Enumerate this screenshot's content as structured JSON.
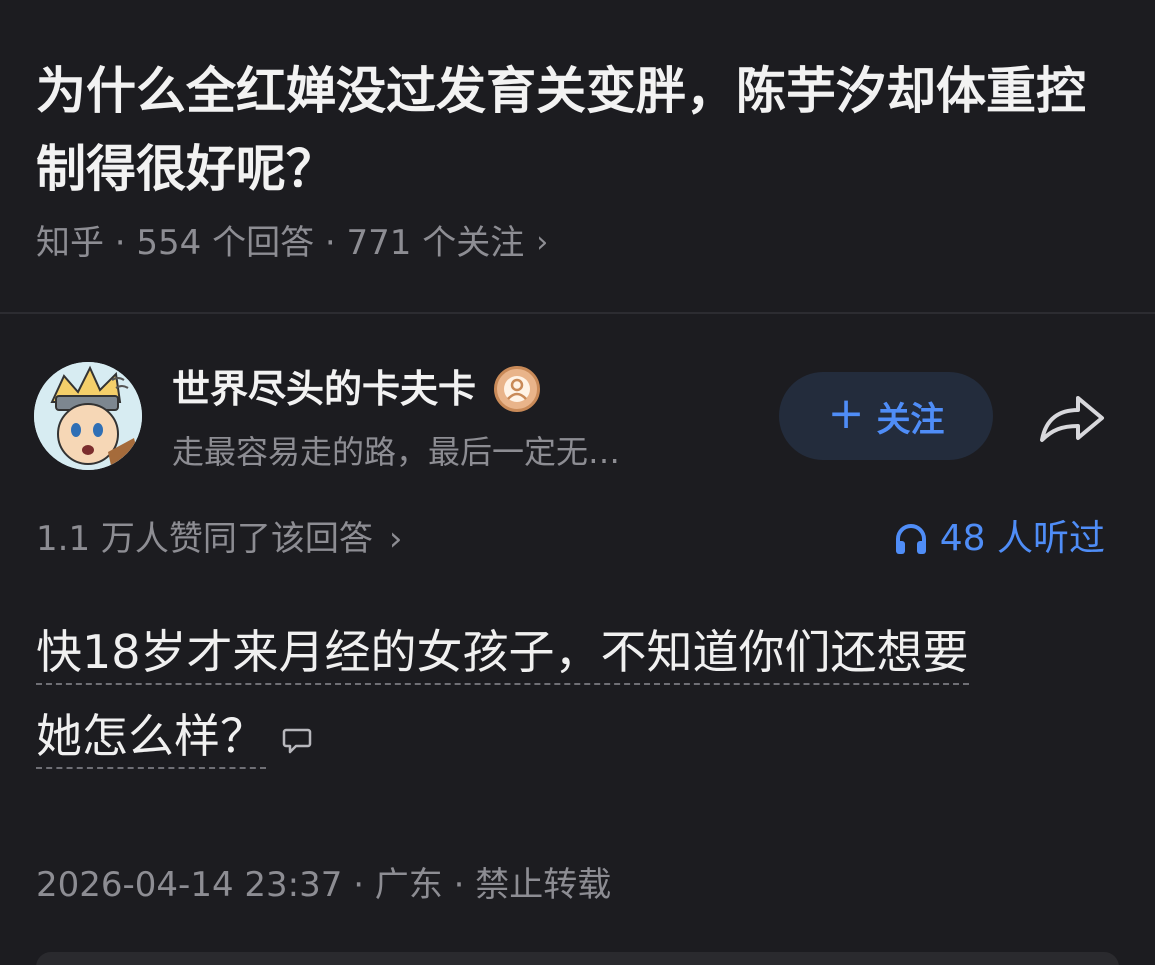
{
  "question": {
    "title": "为什么全红婵没过发育关变胖，陈芋汐却体重控制得很好呢？",
    "meta": "知乎 · 554 个回答 · 771 个关注",
    "meta_chevron": "›"
  },
  "author": {
    "name": "世界尽头的卡夫卡",
    "bio": "走最容易走的路，最后一定无…",
    "avatar_icon": "avatar-naruto-icon",
    "badge_icon": "user-badge-icon"
  },
  "actions": {
    "follow_label": "关注",
    "follow_plus": "+",
    "share_icon": "share-icon"
  },
  "stats": {
    "votes": "1.1 万人赞同了该回答",
    "votes_chevron": "›",
    "listen": "48 人听过",
    "listen_icon": "headphones-icon"
  },
  "answer": {
    "line1": "快18岁才来月经的女孩子，不知道你们还想要",
    "line2": "她怎么样？"
  },
  "footer": {
    "info": "2026-04-14 23:37 · 广东 · 禁止转载"
  },
  "colors": {
    "background": "#1c1c20",
    "accent": "#4f8df7",
    "secondary_text": "#8d8d93"
  }
}
